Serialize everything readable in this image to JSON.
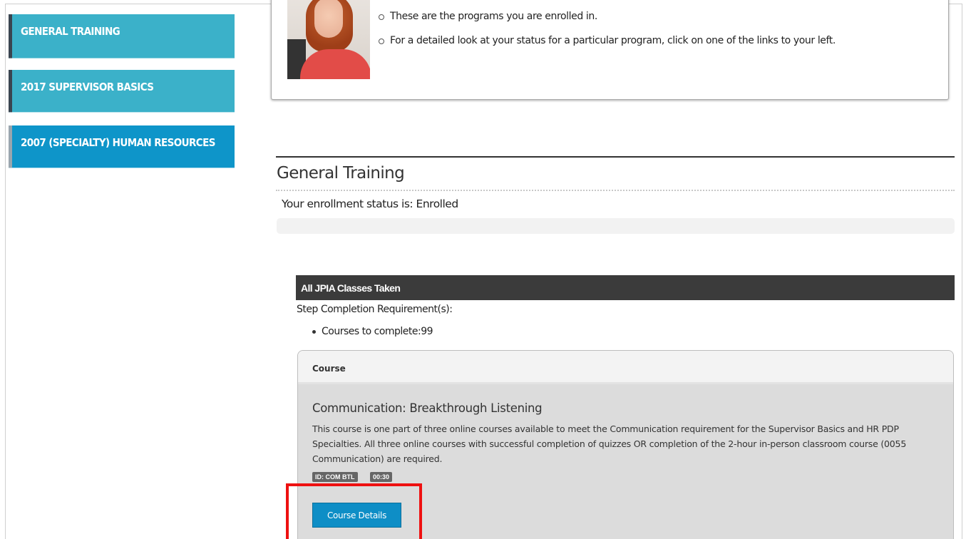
{
  "sidebar": {
    "items": [
      {
        "label": "GENERAL TRAINING"
      },
      {
        "label": "2017 SUPERVISOR BASICS"
      },
      {
        "label": "2007 (SPECIALTY) HUMAN RESOURCES"
      }
    ]
  },
  "info": {
    "lines": [
      "These are the programs you are enrolled in.",
      "For a detailed look at your status for a particular program, click on one of the links to your left."
    ]
  },
  "section": {
    "title": "General Training",
    "enrollment_status": "Your enrollment status is: Enrolled"
  },
  "step": {
    "header": "All JPIA Classes Taken",
    "requirements_label": "Step Completion Requirement(s):",
    "requirements": [
      "Courses to complete:99"
    ]
  },
  "course_table": {
    "column_header": "Course",
    "course": {
      "title": "Communication: Breakthrough Listening",
      "description": "This course is one part of three online courses available to meet the Communication requirement for the Supervisor Basics and HR PDP Specialties. All three online courses with successful completion of quizzes OR completion of the 2-hour in-person classroom course (0055 Communication) are required.",
      "id_badge": "ID: COM BTL",
      "duration_badge": "00:30",
      "details_button": "Course Details"
    }
  },
  "colors": {
    "sidebar_bg": "#3bb1c9",
    "sidebar_active_bg": "#0e95c9",
    "header_dark": "#3b3b3b",
    "button_blue": "#0e8ec6",
    "highlight_red": "#ee1111"
  }
}
